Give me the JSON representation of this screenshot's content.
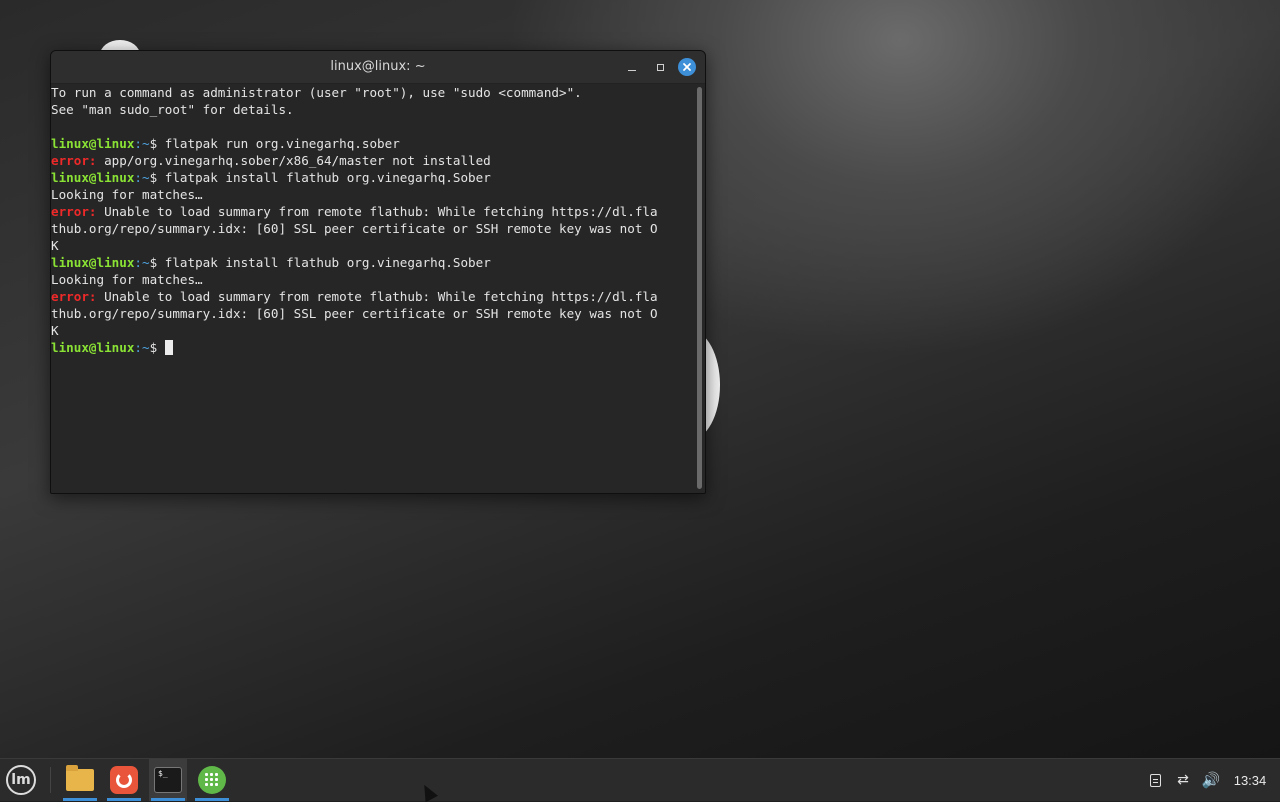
{
  "window": {
    "title": "linux@linux: ~",
    "minimize_icon": "minimize-icon",
    "maximize_icon": "maximize-icon",
    "close_icon": "close-icon"
  },
  "terminal": {
    "colors": {
      "prompt": "#8ae234",
      "path": "#4fa3e0",
      "error": "#ef2929",
      "text": "#e4e4e4"
    },
    "lines": [
      {
        "text": "To run a command as administrator (user \"root\"), use \"sudo <command>\"."
      },
      {
        "text": "See \"man sudo_root\" for details."
      },
      {
        "text": ""
      },
      {
        "prompt": "linux@linux",
        "path": ":~",
        "dollar": "$ ",
        "text": "flatpak run org.vinegarhq.sober"
      },
      {
        "error": "error:",
        "text": " app/org.vinegarhq.sober/x86_64/master not installed"
      },
      {
        "prompt": "linux@linux",
        "path": ":~",
        "dollar": "$ ",
        "text": "flatpak install flathub org.vinegarhq.Sober"
      },
      {
        "text": "Looking for matches…"
      },
      {
        "error": "error:",
        "text": " Unable to load summary from remote flathub: While fetching https://dl.fla"
      },
      {
        "text": "thub.org/repo/summary.idx: [60] SSL peer certificate or SSH remote key was not O"
      },
      {
        "text": "K"
      },
      {
        "prompt": "linux@linux",
        "path": ":~",
        "dollar": "$ ",
        "text": "flatpak install flathub org.vinegarhq.Sober"
      },
      {
        "text": "Looking for matches…"
      },
      {
        "error": "error:",
        "text": " Unable to load summary from remote flathub: While fetching https://dl.fla"
      },
      {
        "text": "thub.org/repo/summary.idx: [60] SSL peer certificate or SSH remote key was not O"
      },
      {
        "text": "K"
      },
      {
        "prompt": "linux@linux",
        "path": ":~",
        "dollar": "$ ",
        "text": "",
        "cursor": true
      }
    ]
  },
  "taskbar": {
    "menu_icon": "mint-menu-icon",
    "menu_glyph": "lm",
    "apps": [
      {
        "name": "files",
        "icon": "folder-icon"
      },
      {
        "name": "firefox",
        "icon": "firefox-icon"
      },
      {
        "name": "terminal",
        "icon": "terminal-icon",
        "glyph": "$_",
        "active": true
      },
      {
        "name": "web-app",
        "icon": "globe-grid-icon"
      }
    ],
    "tray": {
      "notes_icon": "notes-icon",
      "network_icon": "network-icon",
      "network_glyph": "⇄",
      "volume_icon": "volume-icon",
      "volume_glyph": "🔊",
      "clock": "13:34"
    }
  }
}
